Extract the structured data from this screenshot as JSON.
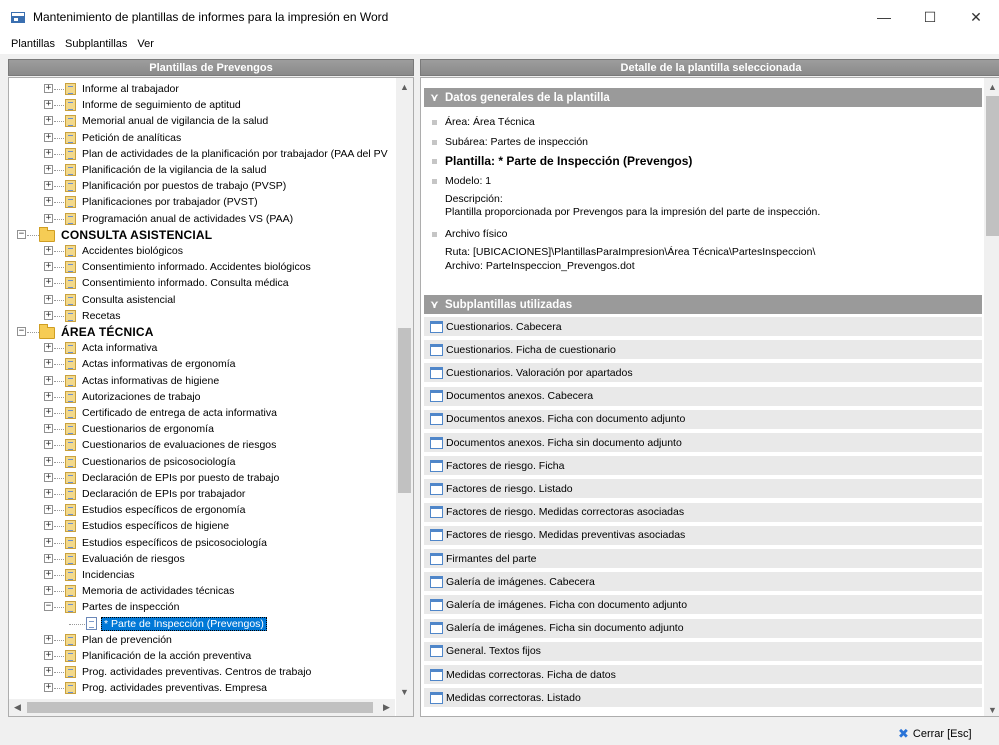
{
  "window": {
    "title": "Mantenimiento de plantillas de informes para la impresión en Word",
    "minimize": "—",
    "maximize": "☐",
    "close": "✕"
  },
  "menu": [
    "Plantillas",
    "Subplantillas",
    "Ver"
  ],
  "left_panel": {
    "title": "Plantillas de Prevengos",
    "tree": [
      {
        "label": "Informe al trabajador",
        "level": 1
      },
      {
        "label": "Informe de seguimiento de aptitud",
        "level": 1
      },
      {
        "label": "Memorial anual de vigilancia de la salud",
        "level": 1
      },
      {
        "label": "Petición de analíticas",
        "level": 1
      },
      {
        "label": "Plan de actividades de la planificación por trabajador (PAA del PV",
        "level": 1
      },
      {
        "label": "Planificación de la vigilancia de la salud",
        "level": 1
      },
      {
        "label": "Planificación por puestos de trabajo (PVSP)",
        "level": 1
      },
      {
        "label": "Planificaciones por trabajador (PVST)",
        "level": 1
      },
      {
        "label": "Programación anual de actividades VS (PAA)",
        "level": 1
      },
      {
        "label": "CONSULTA ASISTENCIAL",
        "level": 0
      },
      {
        "label": "Accidentes biológicos",
        "level": 1
      },
      {
        "label": "Consentimiento informado. Accidentes biológicos",
        "level": 1
      },
      {
        "label": "Consentimiento informado. Consulta médica",
        "level": 1
      },
      {
        "label": "Consulta asistencial",
        "level": 1
      },
      {
        "label": "Recetas",
        "level": 1
      },
      {
        "label": "ÁREA TÉCNICA",
        "level": 0
      },
      {
        "label": "Acta informativa",
        "level": 1
      },
      {
        "label": "Actas informativas de ergonomía",
        "level": 1
      },
      {
        "label": "Actas informativas de higiene",
        "level": 1
      },
      {
        "label": "Autorizaciones de trabajo",
        "level": 1
      },
      {
        "label": "Certificado de entrega de acta informativa",
        "level": 1
      },
      {
        "label": "Cuestionarios de ergonomía",
        "level": 1
      },
      {
        "label": "Cuestionarios de evaluaciones de riesgos",
        "level": 1
      },
      {
        "label": "Cuestionarios de psicosociología",
        "level": 1
      },
      {
        "label": "Declaración de EPIs por puesto de trabajo",
        "level": 1
      },
      {
        "label": "Declaración de EPIs por trabajador",
        "level": 1
      },
      {
        "label": "Estudios específicos de ergonomía",
        "level": 1
      },
      {
        "label": "Estudios específicos de higiene",
        "level": 1
      },
      {
        "label": "Estudios específicos de psicosociología",
        "level": 1
      },
      {
        "label": "Evaluación de riesgos",
        "level": 1
      },
      {
        "label": "Incidencias",
        "level": 1
      },
      {
        "label": "Memoria de actividades técnicas",
        "level": 1
      },
      {
        "label": "Partes de inspección",
        "level": 1,
        "expanded": true
      },
      {
        "label": "* Parte de Inspección (Prevengos)",
        "level": 2,
        "selected": true
      },
      {
        "label": "Plan de prevención",
        "level": 1
      },
      {
        "label": "Planificación de la acción preventiva",
        "level": 1
      },
      {
        "label": "Prog. actividades preventivas. Centros de trabajo",
        "level": 1
      },
      {
        "label": "Prog. actividades preventivas. Empresa",
        "level": 1
      }
    ]
  },
  "right_panel": {
    "title": "Detalle de la plantilla seleccionada",
    "general": {
      "header": "Datos generales de la plantilla",
      "area": "Área: Área Técnica",
      "subarea": "Subárea: Partes de inspección",
      "plantilla": "Plantilla: * Parte de Inspección (Prevengos)",
      "modelo": "Modelo: 1",
      "descripcion_label": "Descripción:",
      "descripcion": "Plantilla proporcionada por Prevengos para la impresión del parte de inspección.",
      "archivo_label": "Archivo físico",
      "ruta": "Ruta: [UBICACIONES]\\PlantillasParaImpresion\\Área Técnica\\PartesInspeccion\\",
      "archivo": "Archivo: ParteInspeccion_Prevengos.dot"
    },
    "subplantillas": {
      "header": "Subplantillas utilizadas",
      "items": [
        "Cuestionarios. Cabecera",
        "Cuestionarios. Ficha de cuestionario",
        "Cuestionarios. Valoración por apartados",
        "Documentos anexos. Cabecera",
        "Documentos anexos. Ficha con documento adjunto",
        "Documentos anexos. Ficha sin documento adjunto",
        "Factores de riesgo. Ficha",
        "Factores de riesgo. Listado",
        "Factores de riesgo. Medidas correctoras asociadas",
        "Factores de riesgo. Medidas preventivas asociadas",
        "Firmantes del parte",
        "Galería de imágenes. Cabecera",
        "Galería de imágenes. Ficha con documento adjunto",
        "Galería de imágenes. Ficha sin documento adjunto",
        "General. Textos fijos",
        "Medidas correctoras. Ficha de datos",
        "Medidas correctoras. Listado"
      ]
    }
  },
  "footer": {
    "close_label": "Cerrar [Esc]"
  }
}
